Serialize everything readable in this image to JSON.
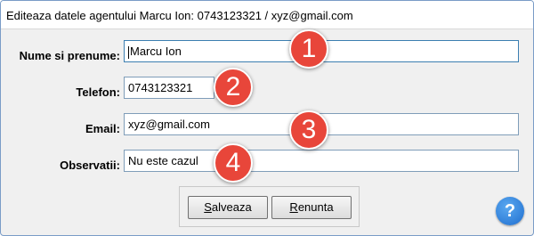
{
  "window": {
    "title": "Editeaza datele agentului Marcu Ion: 0743123321 / xyz@gmail.com"
  },
  "form": {
    "name_label": "Nume si prenume:",
    "name_value": "Marcu Ion",
    "phone_label": "Telefon:",
    "phone_value": "0743123321",
    "email_label": "Email:",
    "email_value": "xyz@gmail.com",
    "notes_label": "Observatii:",
    "notes_value": "Nu este cazul"
  },
  "badges": [
    "1",
    "2",
    "3",
    "4"
  ],
  "buttons": {
    "save_first": "S",
    "save_rest": "alveaza",
    "cancel_first": "R",
    "cancel_rest": "enunta"
  },
  "help": {
    "icon": "help-icon",
    "glyph": "?"
  },
  "colors": {
    "badge": "#e8463a",
    "help": "#1f6ecf"
  }
}
